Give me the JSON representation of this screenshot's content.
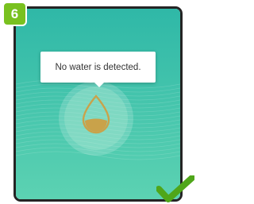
{
  "step": {
    "number": "6"
  },
  "tooltip": {
    "message": "No water is detected."
  },
  "water_sensor": {
    "status": "no-water",
    "icon": "water-drop-icon"
  },
  "colors": {
    "background_top": "#2fb9a8",
    "background_bottom": "#5fd3b4",
    "badge": "#79c11f",
    "drop": "#c9a24a",
    "check": "#4fa61a"
  }
}
